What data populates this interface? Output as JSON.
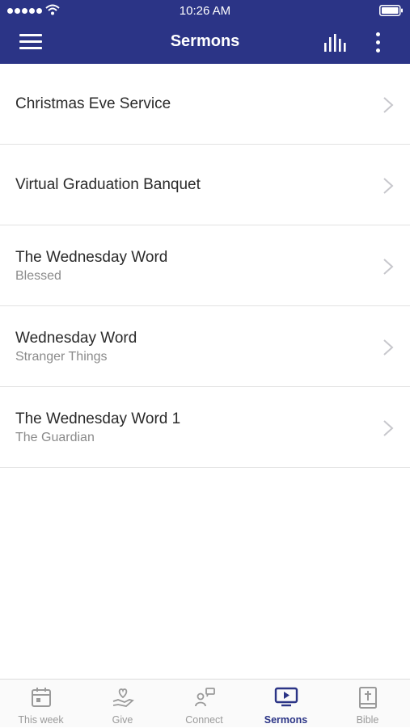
{
  "status_bar": {
    "time": "10:26 AM"
  },
  "header": {
    "title": "Sermons"
  },
  "sermons": [
    {
      "title": "Christmas Eve Service",
      "subtitle": ""
    },
    {
      "title": "Virtual Graduation Banquet",
      "subtitle": ""
    },
    {
      "title": "The Wednesday Word",
      "subtitle": "Blessed"
    },
    {
      "title": "Wednesday Word",
      "subtitle": "Stranger Things"
    },
    {
      "title": "The Wednesday Word 1",
      "subtitle": "The Guardian"
    }
  ],
  "tabs": [
    {
      "label": "This week",
      "icon": "calendar-icon"
    },
    {
      "label": "Give",
      "icon": "hand-heart-icon"
    },
    {
      "label": "Connect",
      "icon": "connect-icon"
    },
    {
      "label": "Sermons",
      "icon": "video-play-icon",
      "active": true
    },
    {
      "label": "Bible",
      "icon": "bible-icon"
    }
  ],
  "colors": {
    "primary": "#2b3486",
    "inactive_tab": "#9a9a9a",
    "divider": "#e3e3e3"
  }
}
